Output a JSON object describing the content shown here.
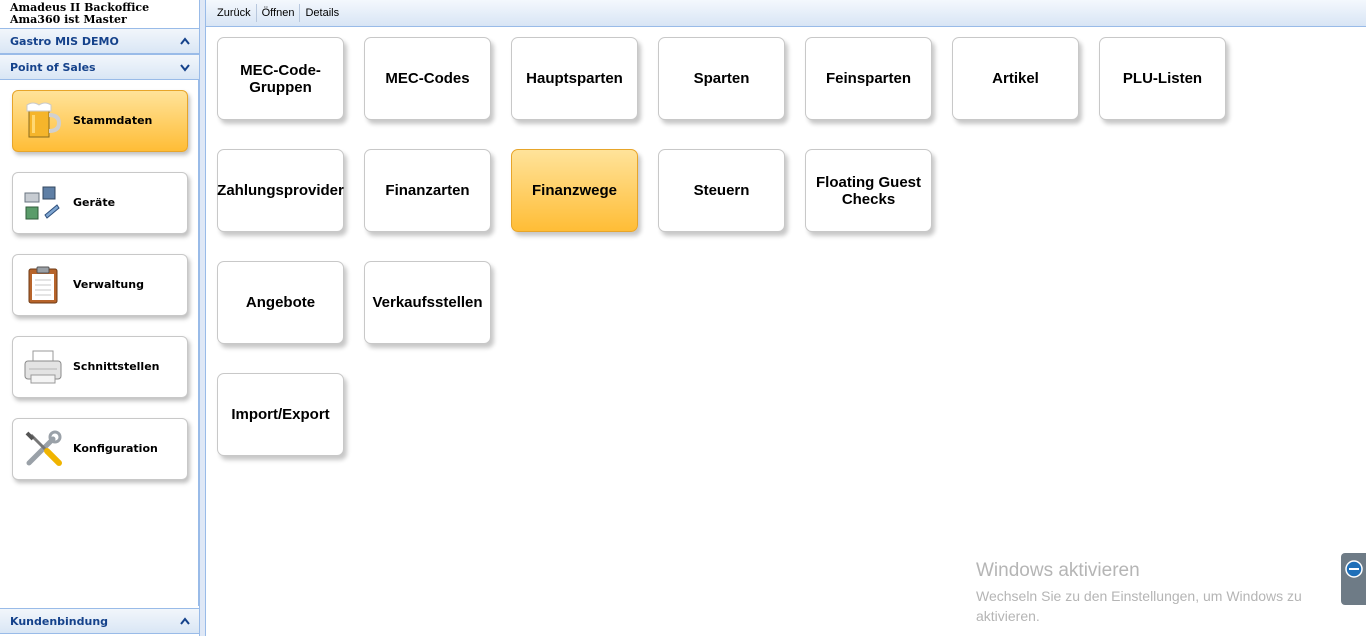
{
  "app": {
    "title_line1": "Amadeus II Backoffice",
    "title_line2": "Ama360 ist Master"
  },
  "sidebar": {
    "header_gastro": "Gastro MIS DEMO",
    "header_pos": "Point of Sales",
    "header_kunden": "Kundenbindung",
    "items": [
      {
        "label": "Stammdaten",
        "icon": "beer-mug-icon",
        "active": true
      },
      {
        "label": "Geräte",
        "icon": "devices-icon",
        "active": false
      },
      {
        "label": "Verwaltung",
        "icon": "clipboard-icon",
        "active": false
      },
      {
        "label": "Schnittstellen",
        "icon": "printer-icon",
        "active": false
      },
      {
        "label": "Konfiguration",
        "icon": "tools-icon",
        "active": false
      }
    ]
  },
  "toolbar": {
    "back_label": "Zurück",
    "open_label": "Öffnen",
    "details_label": "Details"
  },
  "tiles": [
    {
      "label": "MEC-Code-Gruppen",
      "line1": "MEC-Code-",
      "line2": "Gruppen"
    },
    {
      "label": "MEC-Codes"
    },
    {
      "label": "Hauptsparten"
    },
    {
      "label": "Sparten"
    },
    {
      "label": "Feinsparten"
    },
    {
      "label": "Artikel"
    },
    {
      "label": "PLU-Listen"
    },
    {
      "label": "Zahlungsprovider"
    },
    {
      "label": "Finanzarten"
    },
    {
      "label": "Finanzwege",
      "active": true
    },
    {
      "label": "Steuern"
    },
    {
      "label": "Floating Guest Checks",
      "line1": "Floating Guest",
      "line2": "Checks"
    },
    {
      "label": "Angebote"
    },
    {
      "label": "Verkaufsstellen"
    },
    {
      "label": "Import/Export"
    }
  ],
  "watermark": {
    "title": "Windows aktivieren",
    "line1": "Wechseln Sie zu den Einstellungen, um Windows zu",
    "line2": "aktivieren."
  },
  "colors": {
    "accent_orange": "#ffbd36",
    "header_blue": "#15428b",
    "border_blue": "#99bbe8"
  }
}
